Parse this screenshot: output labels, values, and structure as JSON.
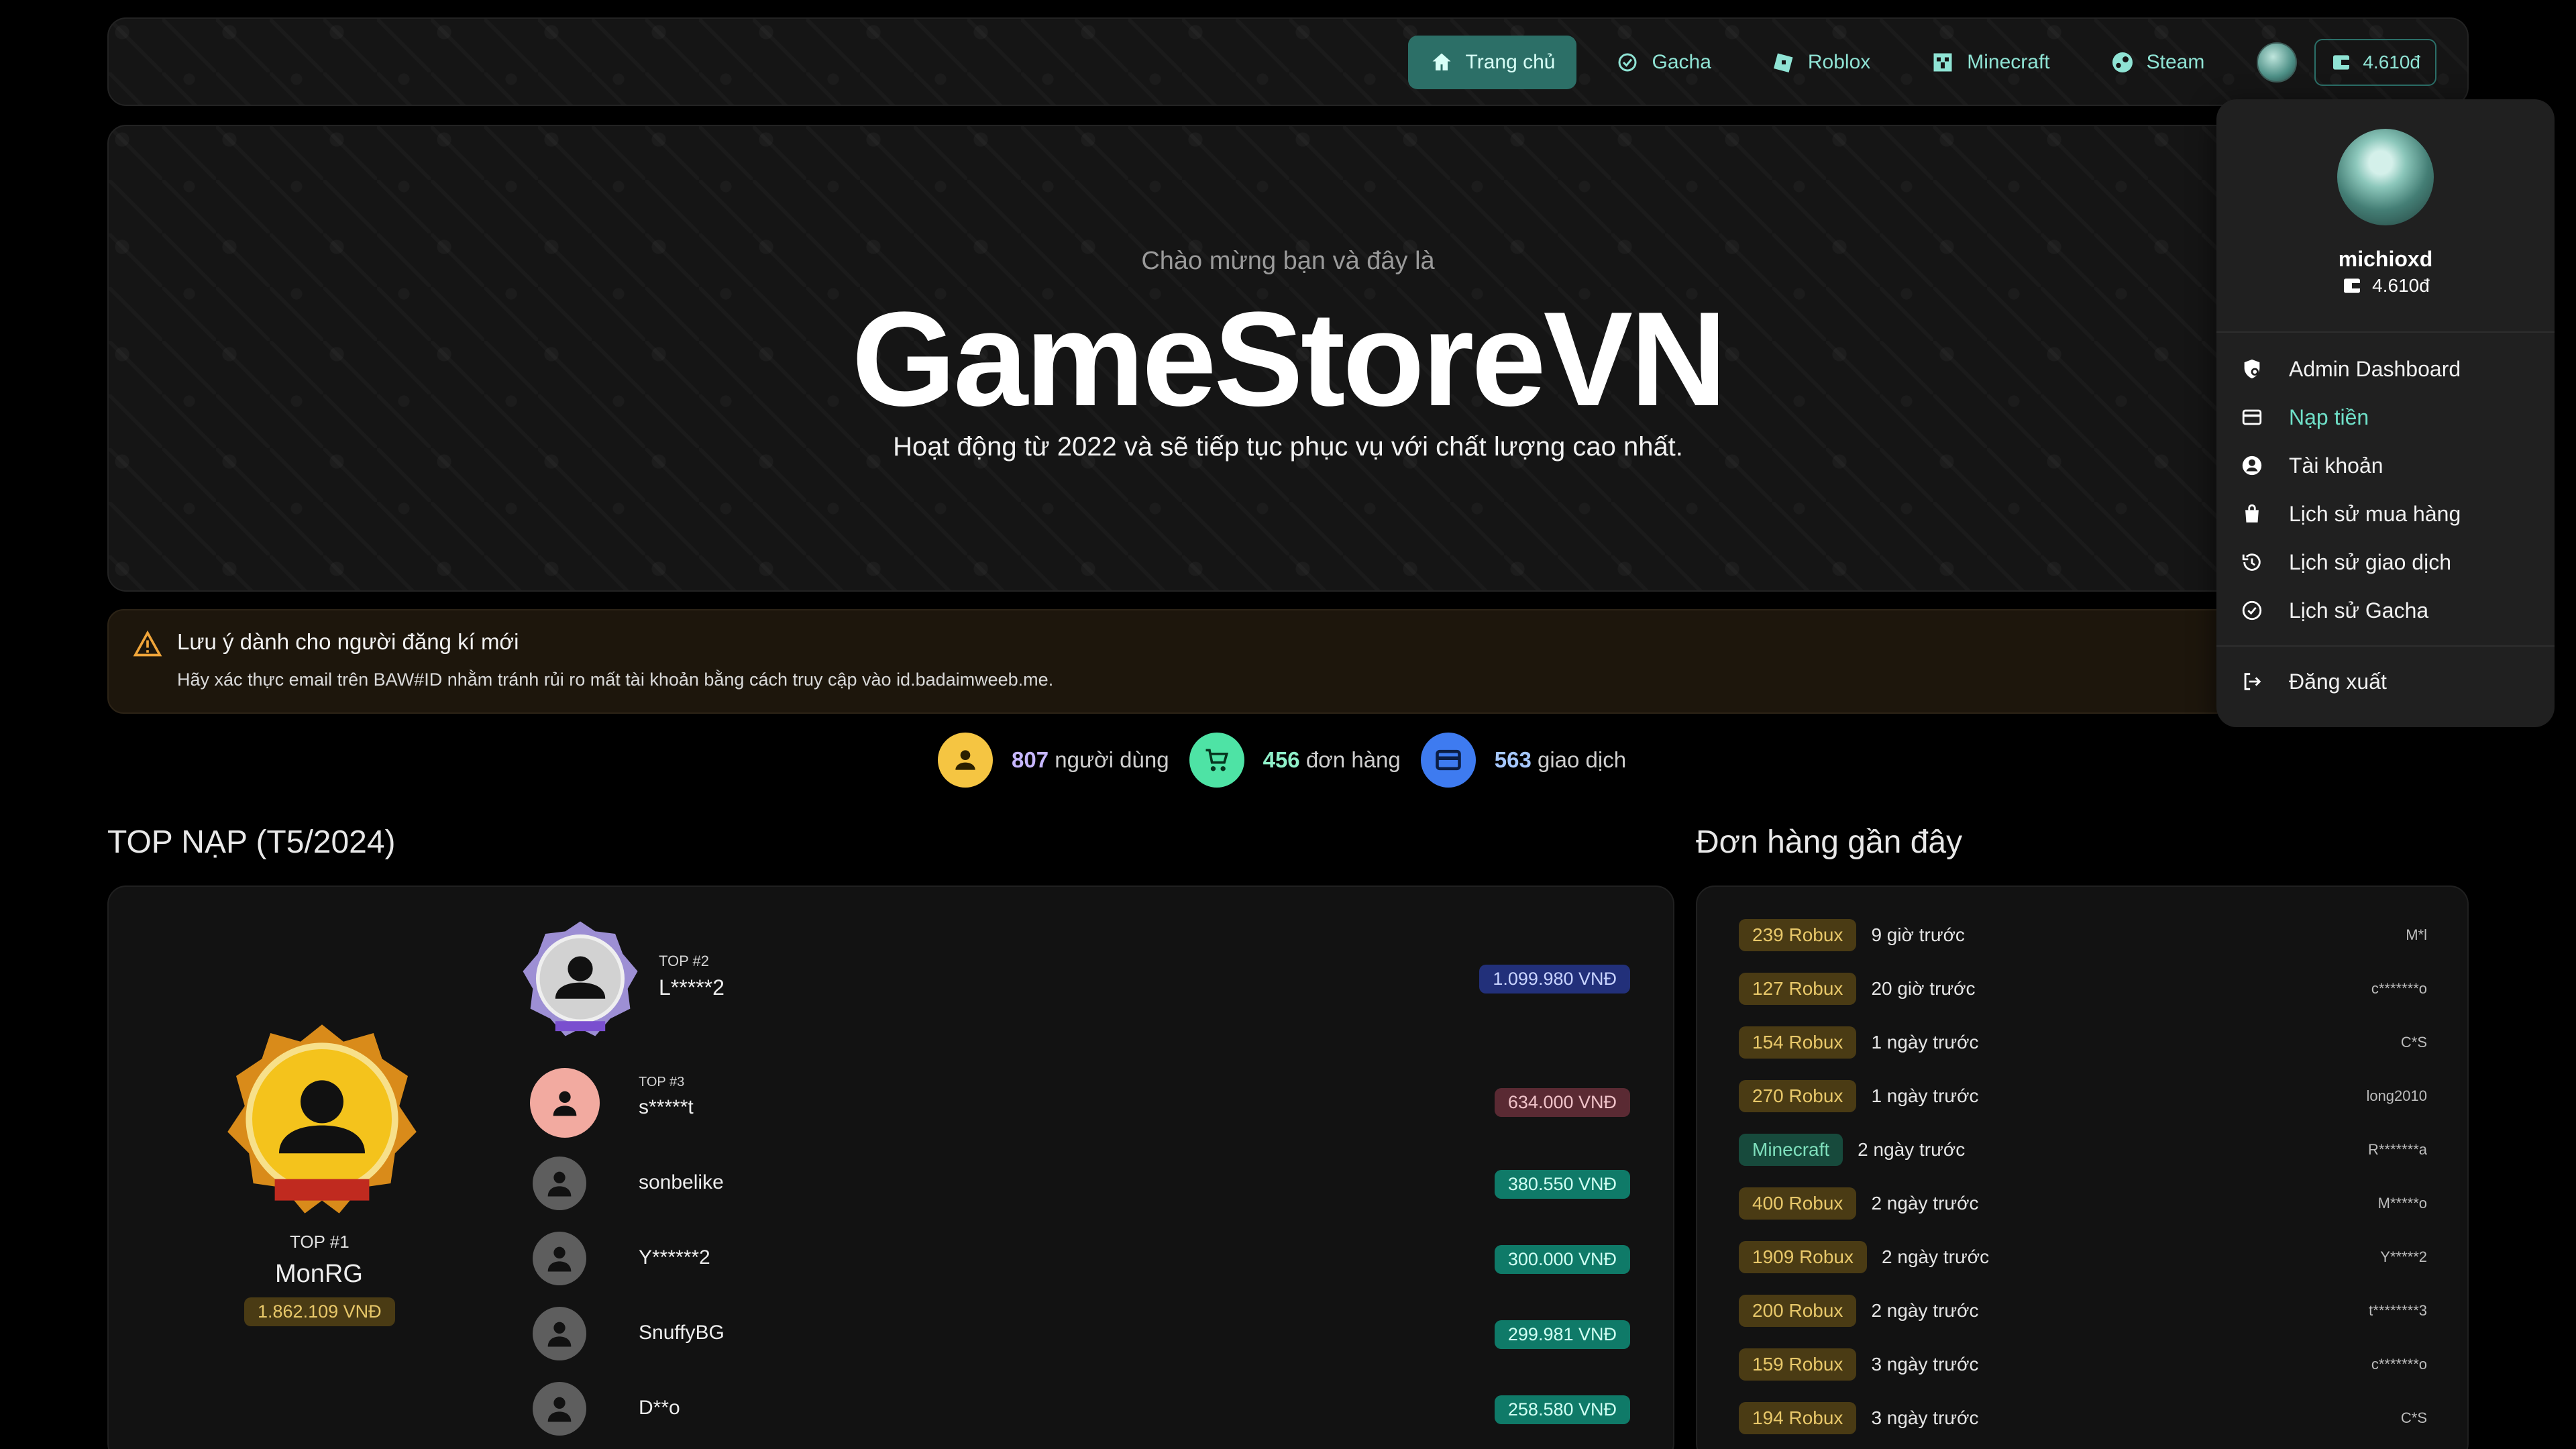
{
  "nav": {
    "items": [
      {
        "label": "Trang chủ",
        "icon": "home-icon"
      },
      {
        "label": "Gacha",
        "icon": "gacha-icon"
      },
      {
        "label": "Roblox",
        "icon": "roblox-icon"
      },
      {
        "label": "Minecraft",
        "icon": "minecraft-icon"
      },
      {
        "label": "Steam",
        "icon": "steam-icon"
      }
    ],
    "balance": "4.610đ"
  },
  "hero": {
    "subtitle": "Chào mừng bạn và đây là",
    "title": "GameStoreVN",
    "description": "Hoạt động từ 2022 và sẽ tiếp tục phục vụ với chất lượng cao nhất."
  },
  "notice": {
    "title": "Lưu ý dành cho người đăng kí mới",
    "text": "Hãy xác thực email trên BAW#ID nhằm tránh rủi ro mất tài khoản bằng cách truy cập vào id.badaimweeb.me."
  },
  "stats": [
    {
      "value": "807",
      "label": "người dùng",
      "color": "#f5c542",
      "numColor": "#c7b7ff"
    },
    {
      "value": "456",
      "label": "đơn hàng",
      "color": "#4ee3a5",
      "numColor": "#8ff0c9"
    },
    {
      "value": "563",
      "label": "giao dịch",
      "color": "#3e7bf0",
      "numColor": "#a6c8ff"
    }
  ],
  "top_section": {
    "title": "TOP NẠP (T5/2024)",
    "first": {
      "label": "TOP #1",
      "name": "MonRG",
      "amount": "1.862.109 VNĐ"
    },
    "second": {
      "label": "TOP #2",
      "name": "L*****2",
      "amount": "1.099.980 VNĐ"
    },
    "third": {
      "label": "TOP #3",
      "name": "s*****t",
      "amount": "634.000 VNĐ"
    },
    "others": [
      {
        "name": "sonbelike",
        "amount": "380.550 VNĐ"
      },
      {
        "name": "Y******2",
        "amount": "300.000 VNĐ"
      },
      {
        "name": "SnuffyBG",
        "amount": "299.981 VNĐ"
      },
      {
        "name": "D**o",
        "amount": "258.580 VNĐ"
      }
    ]
  },
  "orders_section": {
    "title": "Đơn hàng gần đây",
    "orders": [
      {
        "item": "239 Robux",
        "time": "9 giờ trước",
        "user": "M*l",
        "type": "robux"
      },
      {
        "item": "127 Robux",
        "time": "20 giờ trước",
        "user": "c*******o",
        "type": "robux"
      },
      {
        "item": "154 Robux",
        "time": "1 ngày trước",
        "user": "C*S",
        "type": "robux"
      },
      {
        "item": "270 Robux",
        "time": "1 ngày trước",
        "user": "long2010",
        "type": "robux"
      },
      {
        "item": "Minecraft",
        "time": "2 ngày trước",
        "user": "R*******a",
        "type": "minecraft"
      },
      {
        "item": "400 Robux",
        "time": "2 ngày trước",
        "user": "M*****o",
        "type": "robux"
      },
      {
        "item": "1909 Robux",
        "time": "2 ngày trước",
        "user": "Y*****2",
        "type": "robux"
      },
      {
        "item": "200 Robux",
        "time": "2 ngày trước",
        "user": "t********3",
        "type": "robux"
      },
      {
        "item": "159 Robux",
        "time": "3 ngày trước",
        "user": "c*******o",
        "type": "robux"
      },
      {
        "item": "194 Robux",
        "time": "3 ngày trước",
        "user": "C*S",
        "type": "robux"
      }
    ]
  },
  "dropdown": {
    "username": "michioxd",
    "balance": "4.610đ",
    "items": [
      {
        "label": "Admin Dashboard",
        "icon": "shield-gear-icon"
      },
      {
        "label": "Nạp tiền",
        "icon": "card-icon"
      },
      {
        "label": "Tài khoản",
        "icon": "user-circle-icon"
      },
      {
        "label": "Lịch sử mua hàng",
        "icon": "bag-icon"
      },
      {
        "label": "Lịch sử giao dịch",
        "icon": "history-icon"
      },
      {
        "label": "Lịch sử Gacha",
        "icon": "gacha-history-icon"
      }
    ],
    "logout": "Đăng xuất"
  },
  "colors": {
    "accent": "#2c6f67",
    "robux_tag_bg": "#4a3b14",
    "robux_tag_fg": "#e8c86a",
    "minecraft_tag_bg": "#174a3c",
    "minecraft_tag_fg": "#7fe0bd"
  }
}
